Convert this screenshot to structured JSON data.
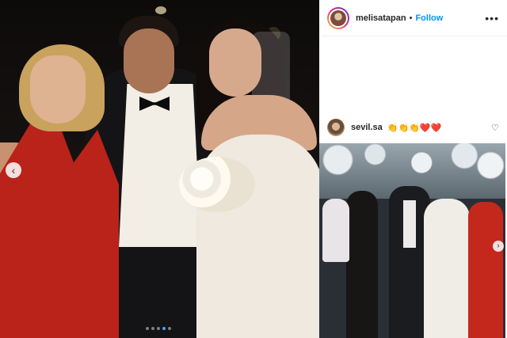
{
  "post": {
    "carousel": {
      "prev_glyph": "‹",
      "slide_count": 5,
      "active_index": 3,
      "dot_active_color": "#4aa3ff"
    }
  },
  "header": {
    "username": "melisatapan",
    "separator": "•",
    "follow_label": "Follow",
    "more_glyph": "•••",
    "follow_color": "#0095f6",
    "avatar_ring_colors": [
      "#f9ce34",
      "#ee2a7b",
      "#6228d7"
    ]
  },
  "comment": {
    "username": "sevil.sa",
    "text": "👏👏👏❤️❤️",
    "heart_glyph": "♡"
  },
  "second_post": {
    "next_glyph": "›"
  }
}
